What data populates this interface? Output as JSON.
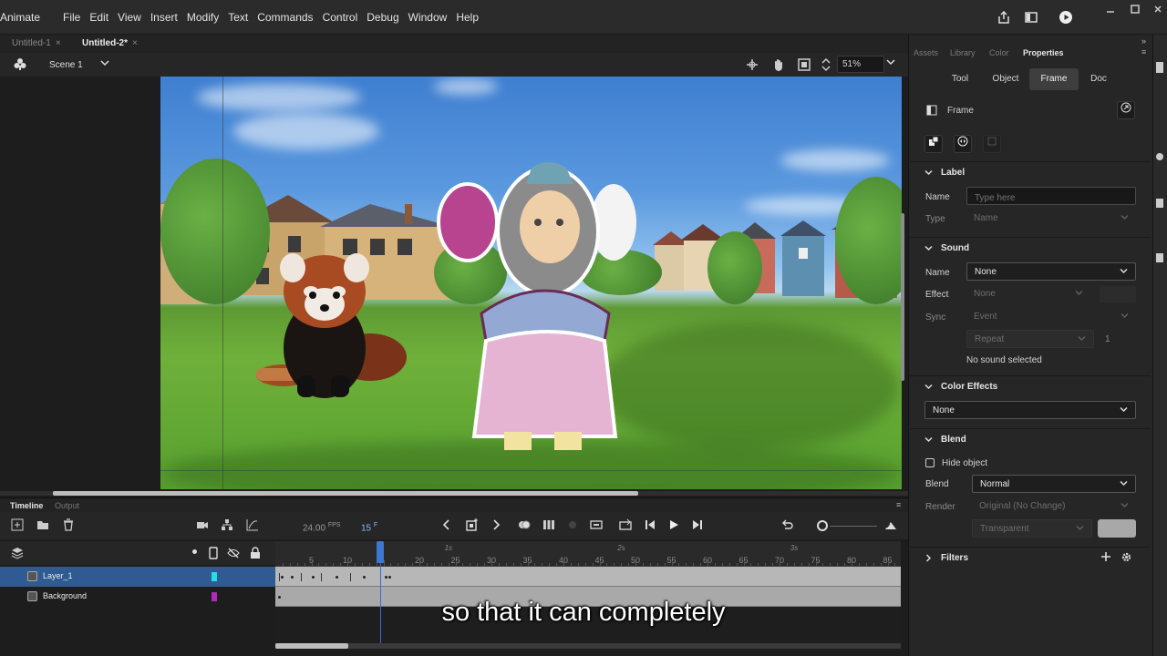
{
  "app": {
    "name": "Animate"
  },
  "menu": [
    "File",
    "Edit",
    "View",
    "Insert",
    "Modify",
    "Text",
    "Commands",
    "Control",
    "Debug",
    "Window",
    "Help"
  ],
  "doc_tabs": [
    {
      "label": "Untitled-1",
      "active": false
    },
    {
      "label": "Untitled-2*",
      "active": true
    }
  ],
  "editbar": {
    "scene": "Scene 1",
    "zoom": "51%"
  },
  "timeline": {
    "tabs": [
      "Timeline",
      "Output"
    ],
    "fps_value": "24.00",
    "fps_unit": "FPS",
    "frame_value": "15",
    "frame_unit": "F",
    "ruler_numbers": [
      "5",
      "10",
      "20",
      "25",
      "30",
      "35",
      "40",
      "45",
      "50",
      "55",
      "60",
      "65",
      "70",
      "75",
      "80",
      "85"
    ],
    "ruler_seconds": [
      "1s",
      "2s",
      "3s"
    ],
    "layers": [
      {
        "name": "Layer_1",
        "color": "#22e0e8",
        "selected": true
      },
      {
        "name": "Background",
        "color": "#b12ab8",
        "selected": false
      }
    ]
  },
  "caption": "so that it can completely",
  "panel": {
    "tabs": [
      "Assets",
      "Library",
      "Color",
      "Properties"
    ],
    "active_tab": "Properties",
    "prop_tabs": [
      "Tool",
      "Object",
      "Frame",
      "Doc"
    ],
    "active_prop_tab": "Frame",
    "frame_title": "Frame",
    "label": {
      "title": "Label",
      "name_label": "Name",
      "name_placeholder": "Type here",
      "type_label": "Type",
      "type_value": "Name"
    },
    "sound": {
      "title": "Sound",
      "name_label": "Name",
      "name_value": "None",
      "effect_label": "Effect",
      "effect_value": "None",
      "sync_label": "Sync",
      "sync_value": "Event",
      "repeat_value": "Repeat",
      "repeat_count": "1",
      "status": "No sound selected"
    },
    "color_effects": {
      "title": "Color Effects",
      "value": "None"
    },
    "blend": {
      "title": "Blend",
      "hide_object": "Hide object",
      "blend_label": "Blend",
      "blend_value": "Normal",
      "render_label": "Render",
      "render_value": "Original (No Change)",
      "bg_value": "Transparent"
    },
    "filters": {
      "title": "Filters"
    }
  },
  "colors": {
    "accent": "#3c78d0",
    "selected_layer": "#2f5b92",
    "panel": "#262626"
  }
}
